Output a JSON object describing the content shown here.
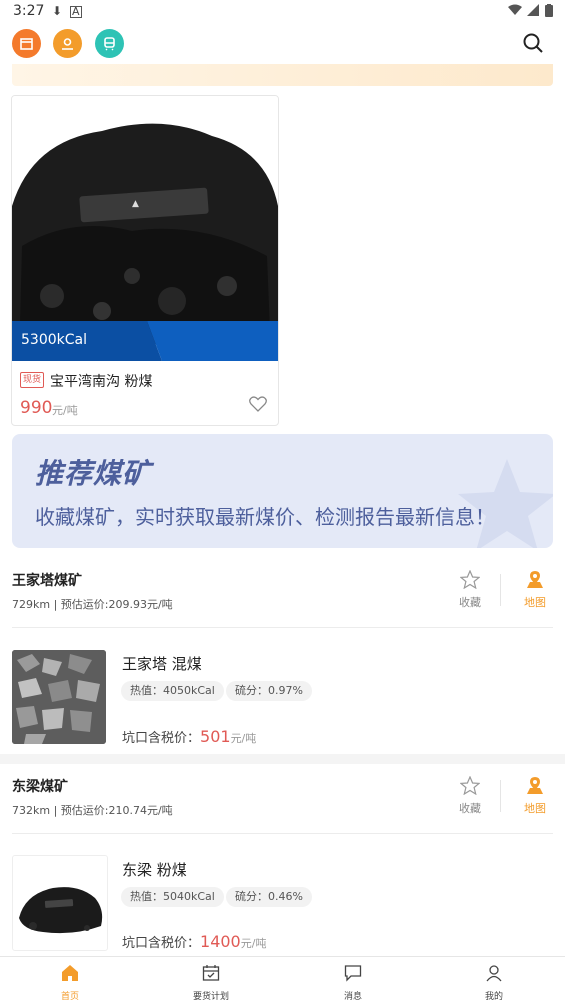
{
  "status_bar": {
    "time": "3:27"
  },
  "featured_product": {
    "calorific_badge": "5300kCal",
    "tag": "现货",
    "name": "宝平湾南沟 粉煤",
    "price": "990",
    "unit": "元/吨"
  },
  "recommend_banner": {
    "title": "推荐煤矿",
    "subtitle": "收藏煤矿，实时获取最新煤价、检测报告最新信息！"
  },
  "mines": [
    {
      "name": "王家塔煤矿",
      "meta": "729km | 预估运价:209.93元/吨",
      "favorite_label": "收藏",
      "map_label": "地图",
      "product": {
        "name": "王家塔 混煤",
        "heat": "热值：4050kCal",
        "sulfur": "硫分：0.97%",
        "price_label": "坑口含税价：",
        "price": "501",
        "unit": "元/吨"
      }
    },
    {
      "name": "东梁煤矿",
      "meta": "732km | 预估运价:210.74元/吨",
      "favorite_label": "收藏",
      "map_label": "地图",
      "product": {
        "name": "东梁 粉煤",
        "heat": "热值：5040kCal",
        "sulfur": "硫分：0.46%",
        "price_label": "坑口含税价：",
        "price": "1400",
        "unit": "元/吨"
      }
    }
  ],
  "tabs": [
    {
      "label": "首页",
      "active": true
    },
    {
      "label": "要货计划",
      "active": false
    },
    {
      "label": "消息",
      "active": false
    },
    {
      "label": "我的",
      "active": false
    }
  ],
  "colors": {
    "accent": "#f39c2b",
    "price": "#e05a55",
    "banner_text": "#4d5f9c",
    "calorific_band": "#0b4fa3"
  }
}
